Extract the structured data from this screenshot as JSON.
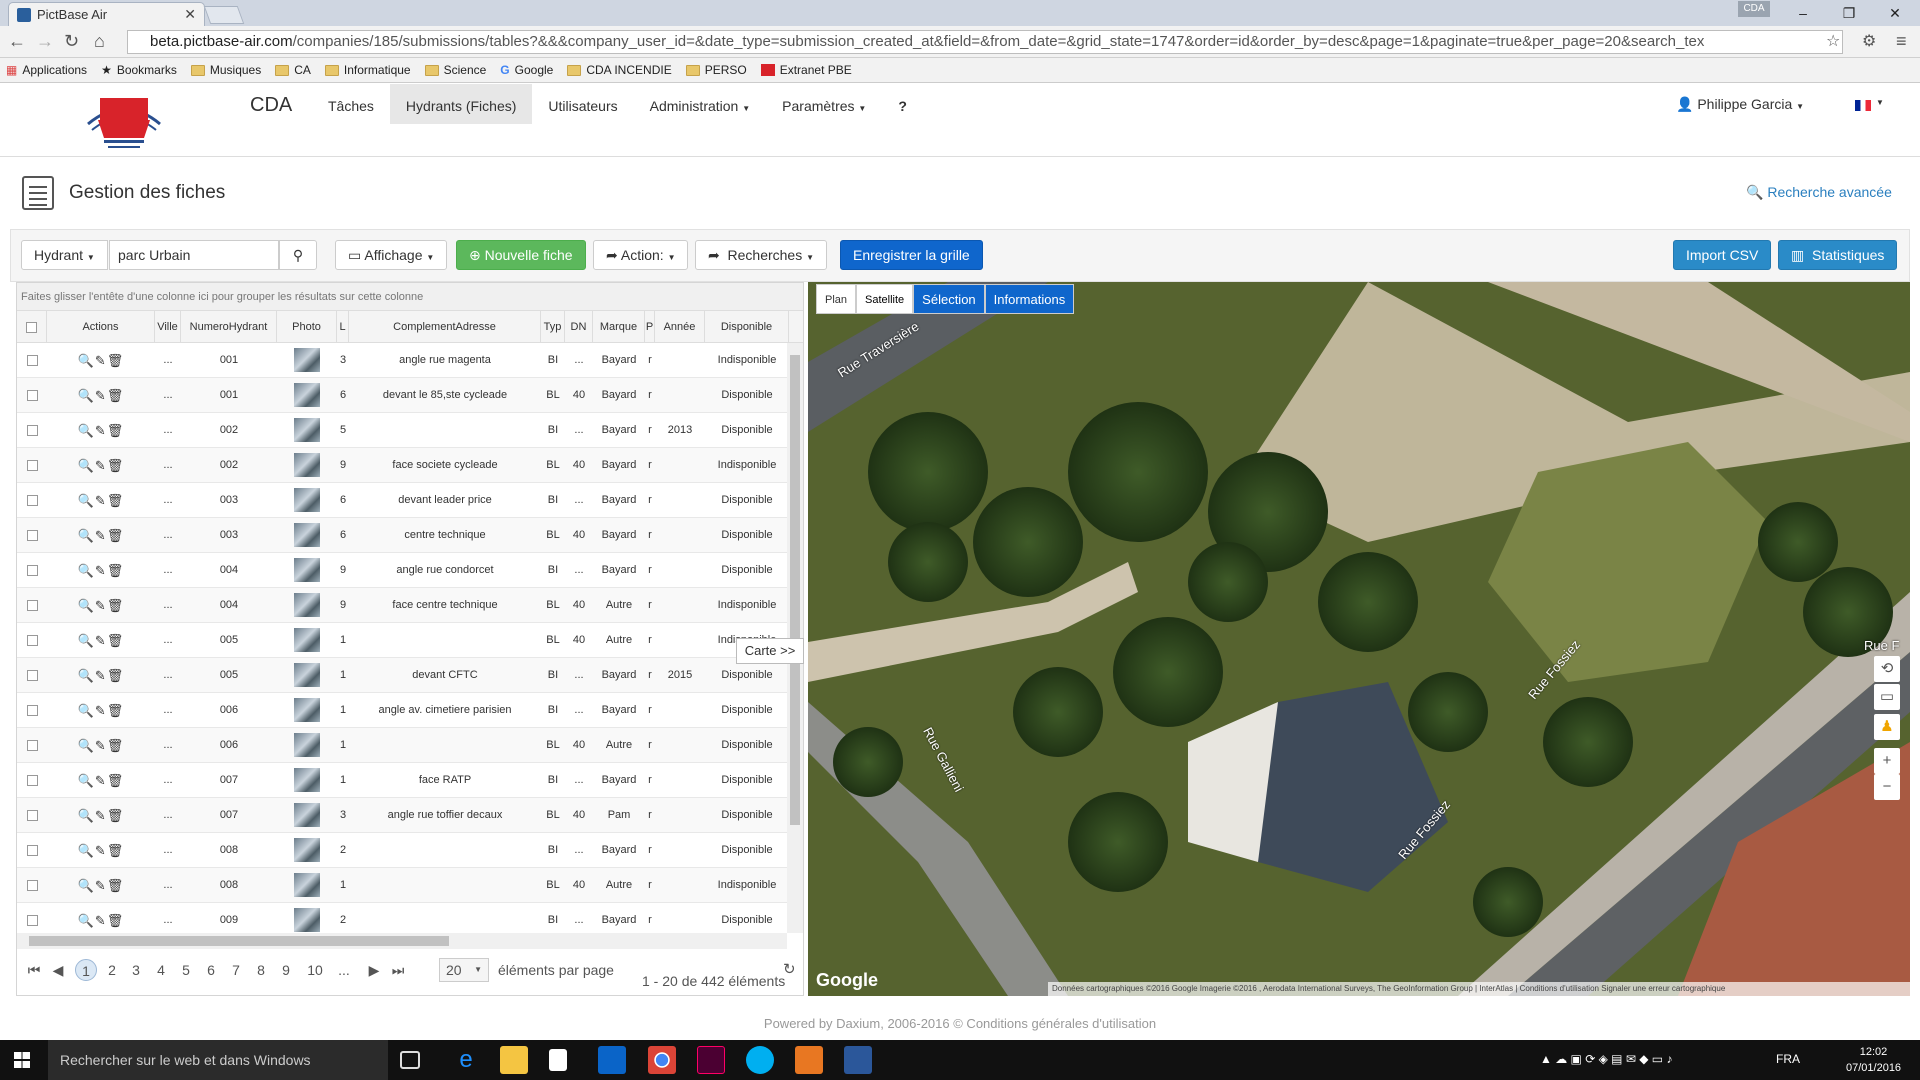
{
  "browser": {
    "tab_title": "PictBase Air",
    "profile_badge": "CDA",
    "url_host": "beta.pictbase-air.com",
    "url_path": "/companies/185/submissions/tables?&&&company_user_id=&date_type=submission_created_at&field=&from_date=&grid_state=1747&order=id&order_by=desc&page=1&paginate=true&per_page=20&search_tex"
  },
  "bookmarks": [
    "Applications",
    "Bookmarks",
    "Musiques",
    "CA",
    "Informatique",
    "Science",
    "Google",
    "CDA INCENDIE",
    "PERSO",
    "Extranet PBE"
  ],
  "navbar": {
    "brand": "CDA",
    "menu": [
      "Tâches",
      "Hydrants (Fiches)",
      "Utilisateurs",
      "Administration",
      "Paramètres",
      "?"
    ],
    "user": "Philippe Garcia"
  },
  "header": {
    "title": "Gestion des fiches",
    "advanced_search": "Recherche avancée"
  },
  "toolbar": {
    "filter_type": "Hydrant",
    "search_value": "parc Urbain",
    "affichage": "Affichage",
    "new": "Nouvelle fiche",
    "action": "Action:",
    "recherches": "Recherches",
    "save_grid": "Enregistrer la grille",
    "import_csv": "Import CSV",
    "stats": "Statistiques"
  },
  "grid": {
    "group_hint": "Faites glisser l'entête d'une colonne ici pour grouper les résultats sur cette colonne",
    "columns": [
      "Actions",
      "Ville",
      "NumeroHydrant",
      "Photo",
      "L",
      "ComplementAdresse",
      "Typ",
      "DN",
      "Marque",
      "P",
      "Année",
      "Disponible"
    ],
    "rows": [
      {
        "ville": "...",
        "num": "001",
        "l": "3",
        "comp": "angle rue magenta",
        "typ": "BI",
        "dn": "...",
        "marque": "Bayard",
        "p": "r",
        "annee": "",
        "dispo": "Indisponible"
      },
      {
        "ville": "...",
        "num": "001",
        "l": "6",
        "comp": "devant le 85,ste cycleade",
        "typ": "BL",
        "dn": "40",
        "marque": "Bayard",
        "p": "r",
        "annee": "",
        "dispo": "Disponible"
      },
      {
        "ville": "...",
        "num": "002",
        "l": "5",
        "comp": "",
        "typ": "BI",
        "dn": "...",
        "marque": "Bayard",
        "p": "r",
        "annee": "2013",
        "dispo": "Disponible"
      },
      {
        "ville": "...",
        "num": "002",
        "l": "9",
        "comp": "face societe cycleade",
        "typ": "BL",
        "dn": "40",
        "marque": "Bayard",
        "p": "r",
        "annee": "",
        "dispo": "Indisponible"
      },
      {
        "ville": "...",
        "num": "003",
        "l": "6",
        "comp": "devant leader price",
        "typ": "BI",
        "dn": "...",
        "marque": "Bayard",
        "p": "r",
        "annee": "",
        "dispo": "Disponible"
      },
      {
        "ville": "...",
        "num": "003",
        "l": "6",
        "comp": "centre technique",
        "typ": "BL",
        "dn": "40",
        "marque": "Bayard",
        "p": "r",
        "annee": "",
        "dispo": "Disponible"
      },
      {
        "ville": "...",
        "num": "004",
        "l": "9",
        "comp": "angle rue condorcet",
        "typ": "BI",
        "dn": "...",
        "marque": "Bayard",
        "p": "r",
        "annee": "",
        "dispo": "Disponible"
      },
      {
        "ville": "...",
        "num": "004",
        "l": "9",
        "comp": "face centre technique",
        "typ": "BL",
        "dn": "40",
        "marque": "Autre",
        "p": "r",
        "annee": "",
        "dispo": "Indisponible"
      },
      {
        "ville": "...",
        "num": "005",
        "l": "1",
        "comp": "",
        "typ": "BL",
        "dn": "40",
        "marque": "Autre",
        "p": "r",
        "annee": "",
        "dispo": "Indisponible"
      },
      {
        "ville": "...",
        "num": "005",
        "l": "1",
        "comp": "devant CFTC",
        "typ": "BI",
        "dn": "...",
        "marque": "Bayard",
        "p": "r",
        "annee": "2015",
        "dispo": "Disponible"
      },
      {
        "ville": "...",
        "num": "006",
        "l": "1",
        "comp": "angle av. cimetiere parisien",
        "typ": "BI",
        "dn": "...",
        "marque": "Bayard",
        "p": "r",
        "annee": "",
        "dispo": "Disponible"
      },
      {
        "ville": "...",
        "num": "006",
        "l": "1",
        "comp": "",
        "typ": "BL",
        "dn": "40",
        "marque": "Autre",
        "p": "r",
        "annee": "",
        "dispo": "Disponible"
      },
      {
        "ville": "...",
        "num": "007",
        "l": "1",
        "comp": "face RATP",
        "typ": "BI",
        "dn": "...",
        "marque": "Bayard",
        "p": "r",
        "annee": "",
        "dispo": "Disponible"
      },
      {
        "ville": "...",
        "num": "007",
        "l": "3",
        "comp": "angle rue toffier decaux",
        "typ": "BL",
        "dn": "40",
        "marque": "Pam",
        "p": "r",
        "annee": "",
        "dispo": "Disponible"
      },
      {
        "ville": "...",
        "num": "008",
        "l": "2",
        "comp": "",
        "typ": "BI",
        "dn": "...",
        "marque": "Bayard",
        "p": "r",
        "annee": "",
        "dispo": "Disponible"
      },
      {
        "ville": "...",
        "num": "008",
        "l": "1",
        "comp": "",
        "typ": "BL",
        "dn": "40",
        "marque": "Autre",
        "p": "r",
        "annee": "",
        "dispo": "Indisponible"
      },
      {
        "ville": "...",
        "num": "009",
        "l": "2",
        "comp": "",
        "typ": "BI",
        "dn": "...",
        "marque": "Bayard",
        "p": "r",
        "annee": "",
        "dispo": "Disponible"
      }
    ],
    "pages": [
      "1",
      "2",
      "3",
      "4",
      "5",
      "6",
      "7",
      "8",
      "9",
      "10",
      "..."
    ],
    "per_page": "20",
    "per_page_label": "éléments par page",
    "summary": "1 - 20 de 442 éléments"
  },
  "map": {
    "tab_plan": "Plan",
    "tab_satellite": "Satellite",
    "tab_selection": "Sélection",
    "tab_informations": "Informations",
    "carte_button": "Carte >>",
    "google": "Google",
    "attribution": "Données cartographiques ©2016 Google Imagerie ©2016 , Aerodata International Surveys, The GeoInformation Group | InterAtlas | Conditions d'utilisation   Signaler une erreur cartographique",
    "street_labels": [
      "Rue Traversière",
      "Rue Gallieni",
      "Rue Fossiez",
      "Rue Fossiez",
      "Rue F"
    ]
  },
  "footer": {
    "text": "Powered by Daxium, 2006-2016 ©   Conditions générales d'utilisation"
  },
  "taskbar": {
    "search": "Rechercher sur le web et dans Windows",
    "lang": "FRA",
    "time": "12:02",
    "date": "07/01/2016"
  }
}
